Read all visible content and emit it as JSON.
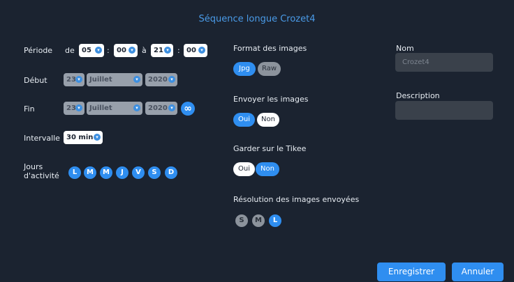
{
  "title": "Séquence longue Crozet4",
  "period": {
    "label": "Période",
    "de": "de",
    "a": "à",
    "sep": ":",
    "start_h": "05",
    "start_m": "00",
    "end_h": "21",
    "end_m": "00"
  },
  "debut": {
    "label": "Début",
    "day": "23",
    "month": "Juillet",
    "year": "2020"
  },
  "fin": {
    "label": "Fin",
    "day": "23",
    "month": "Juillet",
    "year": "2020",
    "infinity": "∞"
  },
  "intervalle": {
    "label": "Intervalle",
    "value": "30 min"
  },
  "jours": {
    "label_line1": "Jours",
    "label_line2": "d'activité",
    "days": [
      "L",
      "M",
      "M",
      "J",
      "V",
      "S",
      "D"
    ]
  },
  "format": {
    "label": "Format des images",
    "jpg": "Jpg",
    "raw": "Raw"
  },
  "envoyer": {
    "label": "Envoyer les images",
    "oui": "Oui",
    "non": "Non"
  },
  "garder": {
    "label": "Garder sur le Tikee",
    "oui": "Oui",
    "non": "Non"
  },
  "resolution": {
    "label": "Résolution des images envoyées",
    "s": "S",
    "m": "M",
    "l": "L"
  },
  "nom": {
    "label": "Nom",
    "value": "Crozet4"
  },
  "description": {
    "label": "Description",
    "value": ""
  },
  "buttons": {
    "save": "Enregistrer",
    "cancel": "Annuler"
  },
  "colors": {
    "background": "#1b2330",
    "accent": "#2f8ef0",
    "title": "#4a9be8"
  },
  "icons": {
    "dropdown": "chevron-down-icon",
    "infinity": "infinity-icon"
  }
}
